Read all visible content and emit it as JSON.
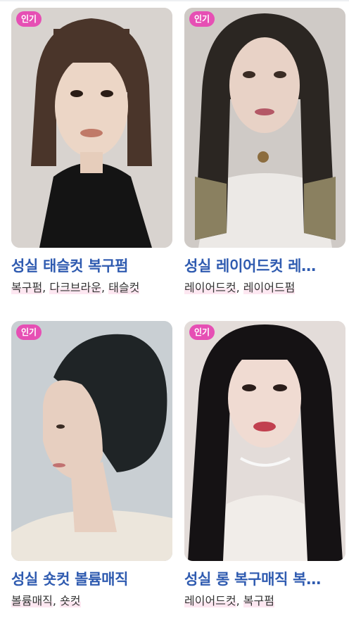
{
  "badge_label": "인기",
  "colors": {
    "badge": "#e64fb4",
    "title": "#2f5bb0",
    "tag_highlight": "#fde7f1"
  },
  "cards": [
    {
      "title": "성실 태슬컷 복구펌",
      "tags": [
        "복구펌",
        "다크브라운",
        "태슬컷"
      ]
    },
    {
      "title": "성실 레이어드컷 레…",
      "tags": [
        "레이어드컷",
        "레이어드펌"
      ]
    },
    {
      "title": "성실 숏컷 볼륨매직",
      "tags": [
        "볼륨매직",
        "숏컷"
      ]
    },
    {
      "title": "성실 롱 복구매직 복…",
      "tags": [
        "레이어드컷",
        "복구펌"
      ]
    }
  ]
}
